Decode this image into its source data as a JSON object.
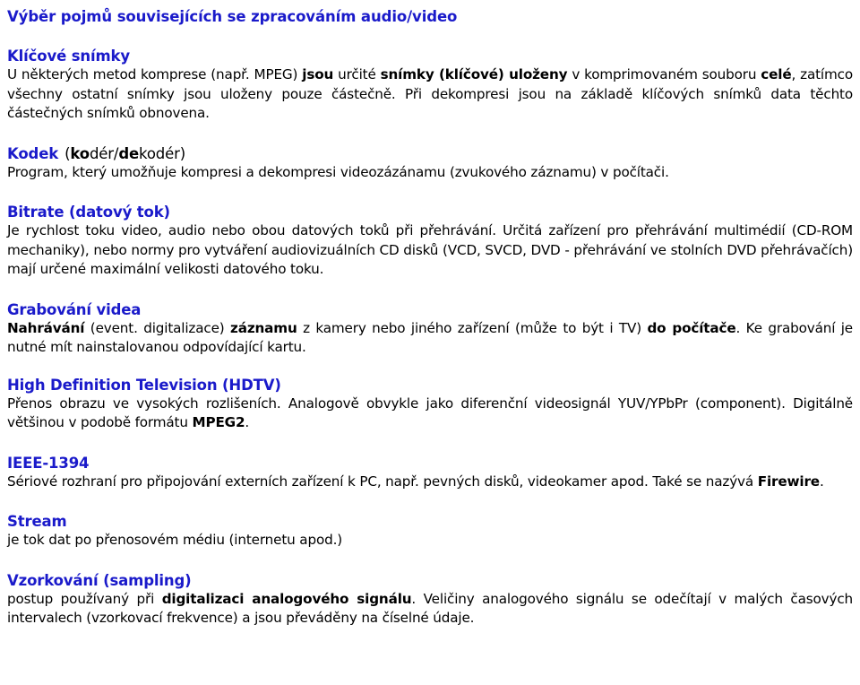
{
  "document": {
    "title": "Výběr pojmů souvisejících se zpracováním audio/video",
    "title_color": "#1a1aca",
    "body_color": "#000000",
    "sections": [
      {
        "id": "klicove-snimky",
        "heading": "Klíčové snímky",
        "heading_suffix": "",
        "paragraphs": [
          {
            "runs": [
              {
                "text": "U některých metod komprese (např. MPEG) ",
                "bold": false
              },
              {
                "text": "jsou",
                "bold": true
              },
              {
                "text": " určité ",
                "bold": false
              },
              {
                "text": "snímky (klíčové) uloženy",
                "bold": true
              },
              {
                "text": " v komprimovaném souboru ",
                "bold": false
              },
              {
                "text": "celé",
                "bold": true
              },
              {
                "text": ", zatímco všechny ostatní snímky jsou uloženy pouze částečně. Při dekompresi jsou na základě klíčových snímků data těchto částečných snímků obnovena.",
                "bold": false
              }
            ]
          }
        ]
      },
      {
        "id": "kodek",
        "heading": "Kodek",
        "heading_suffix_runs": [
          {
            "text": "(",
            "bold": false
          },
          {
            "text": "ko",
            "bold": true
          },
          {
            "text": "dér/",
            "bold": false
          },
          {
            "text": "de",
            "bold": true
          },
          {
            "text": "kodér)",
            "bold": false
          }
        ],
        "paragraphs": [
          {
            "runs": [
              {
                "text": "Program, který umožňuje kompresi a dekompresi videozázánamu (zvukového záznamu) v počítači.",
                "bold": false
              }
            ]
          }
        ]
      },
      {
        "id": "bitrate",
        "heading": "Bitrate (datový tok)",
        "paragraphs": [
          {
            "runs": [
              {
                "text": "Je rychlost toku video, audio nebo obou datových toků při přehrávání. Určitá zařízení pro přehrávání multimédií (CD-ROM mechaniky), nebo normy pro vytváření audiovizuálních CD disků (VCD, SVCD, DVD - přehrávání ve stolních DVD přehrávačích) mají určené maximální velikosti datového toku.",
                "bold": false
              }
            ]
          }
        ]
      },
      {
        "id": "grabovani-videa",
        "heading": "Grabování videa",
        "paragraphs": [
          {
            "runs": [
              {
                "text": "Nahrávání",
                "bold": true
              },
              {
                "text": " (event. digitalizace) ",
                "bold": false
              },
              {
                "text": "záznamu",
                "bold": true
              },
              {
                "text": " z kamery nebo jiného zařízení (může to být i TV) ",
                "bold": false
              },
              {
                "text": "do počítače",
                "bold": true
              },
              {
                "text": ". Ke grabování je nutné mít nainstalovanou odpovídající kartu.",
                "bold": false
              }
            ]
          }
        ]
      },
      {
        "id": "hdtv",
        "heading": "High Definition Television (HDTV)",
        "paragraphs": [
          {
            "runs": [
              {
                "text": "Přenos obrazu ve vysokých rozlišeních. Analogově obvykle jako diferenční videosignál YUV/YPbPr (component). Digitálně většinou v podobě formátu ",
                "bold": false
              },
              {
                "text": "MPEG2",
                "bold": true
              },
              {
                "text": ".",
                "bold": false
              }
            ]
          }
        ]
      },
      {
        "id": "ieee-1394",
        "heading": "IEEE-1394",
        "paragraphs": [
          {
            "runs": [
              {
                "text": "Sériové rozhraní pro připojování externích zařízení k PC, např. pevných disků, videokamer apod. Také se nazývá ",
                "bold": false
              },
              {
                "text": "Firewire",
                "bold": true
              },
              {
                "text": ".",
                "bold": false
              }
            ]
          }
        ]
      },
      {
        "id": "stream",
        "heading": "Stream",
        "paragraphs": [
          {
            "runs": [
              {
                "text": "je tok dat po přenosovém médiu (internetu apod.)",
                "bold": false
              }
            ]
          }
        ]
      },
      {
        "id": "vzorkovani",
        "heading": "Vzorkování (sampling)",
        "paragraphs": [
          {
            "runs": [
              {
                "text": "postup používaný při ",
                "bold": false
              },
              {
                "text": "digitalizaci analogového signálu",
                "bold": true
              },
              {
                "text": ". Veličiny analogového signálu se odečítají v malých časových intervalech (vzorkovací frekvence) a jsou převáděny na číselné údaje.",
                "bold": false
              }
            ]
          }
        ]
      }
    ]
  }
}
